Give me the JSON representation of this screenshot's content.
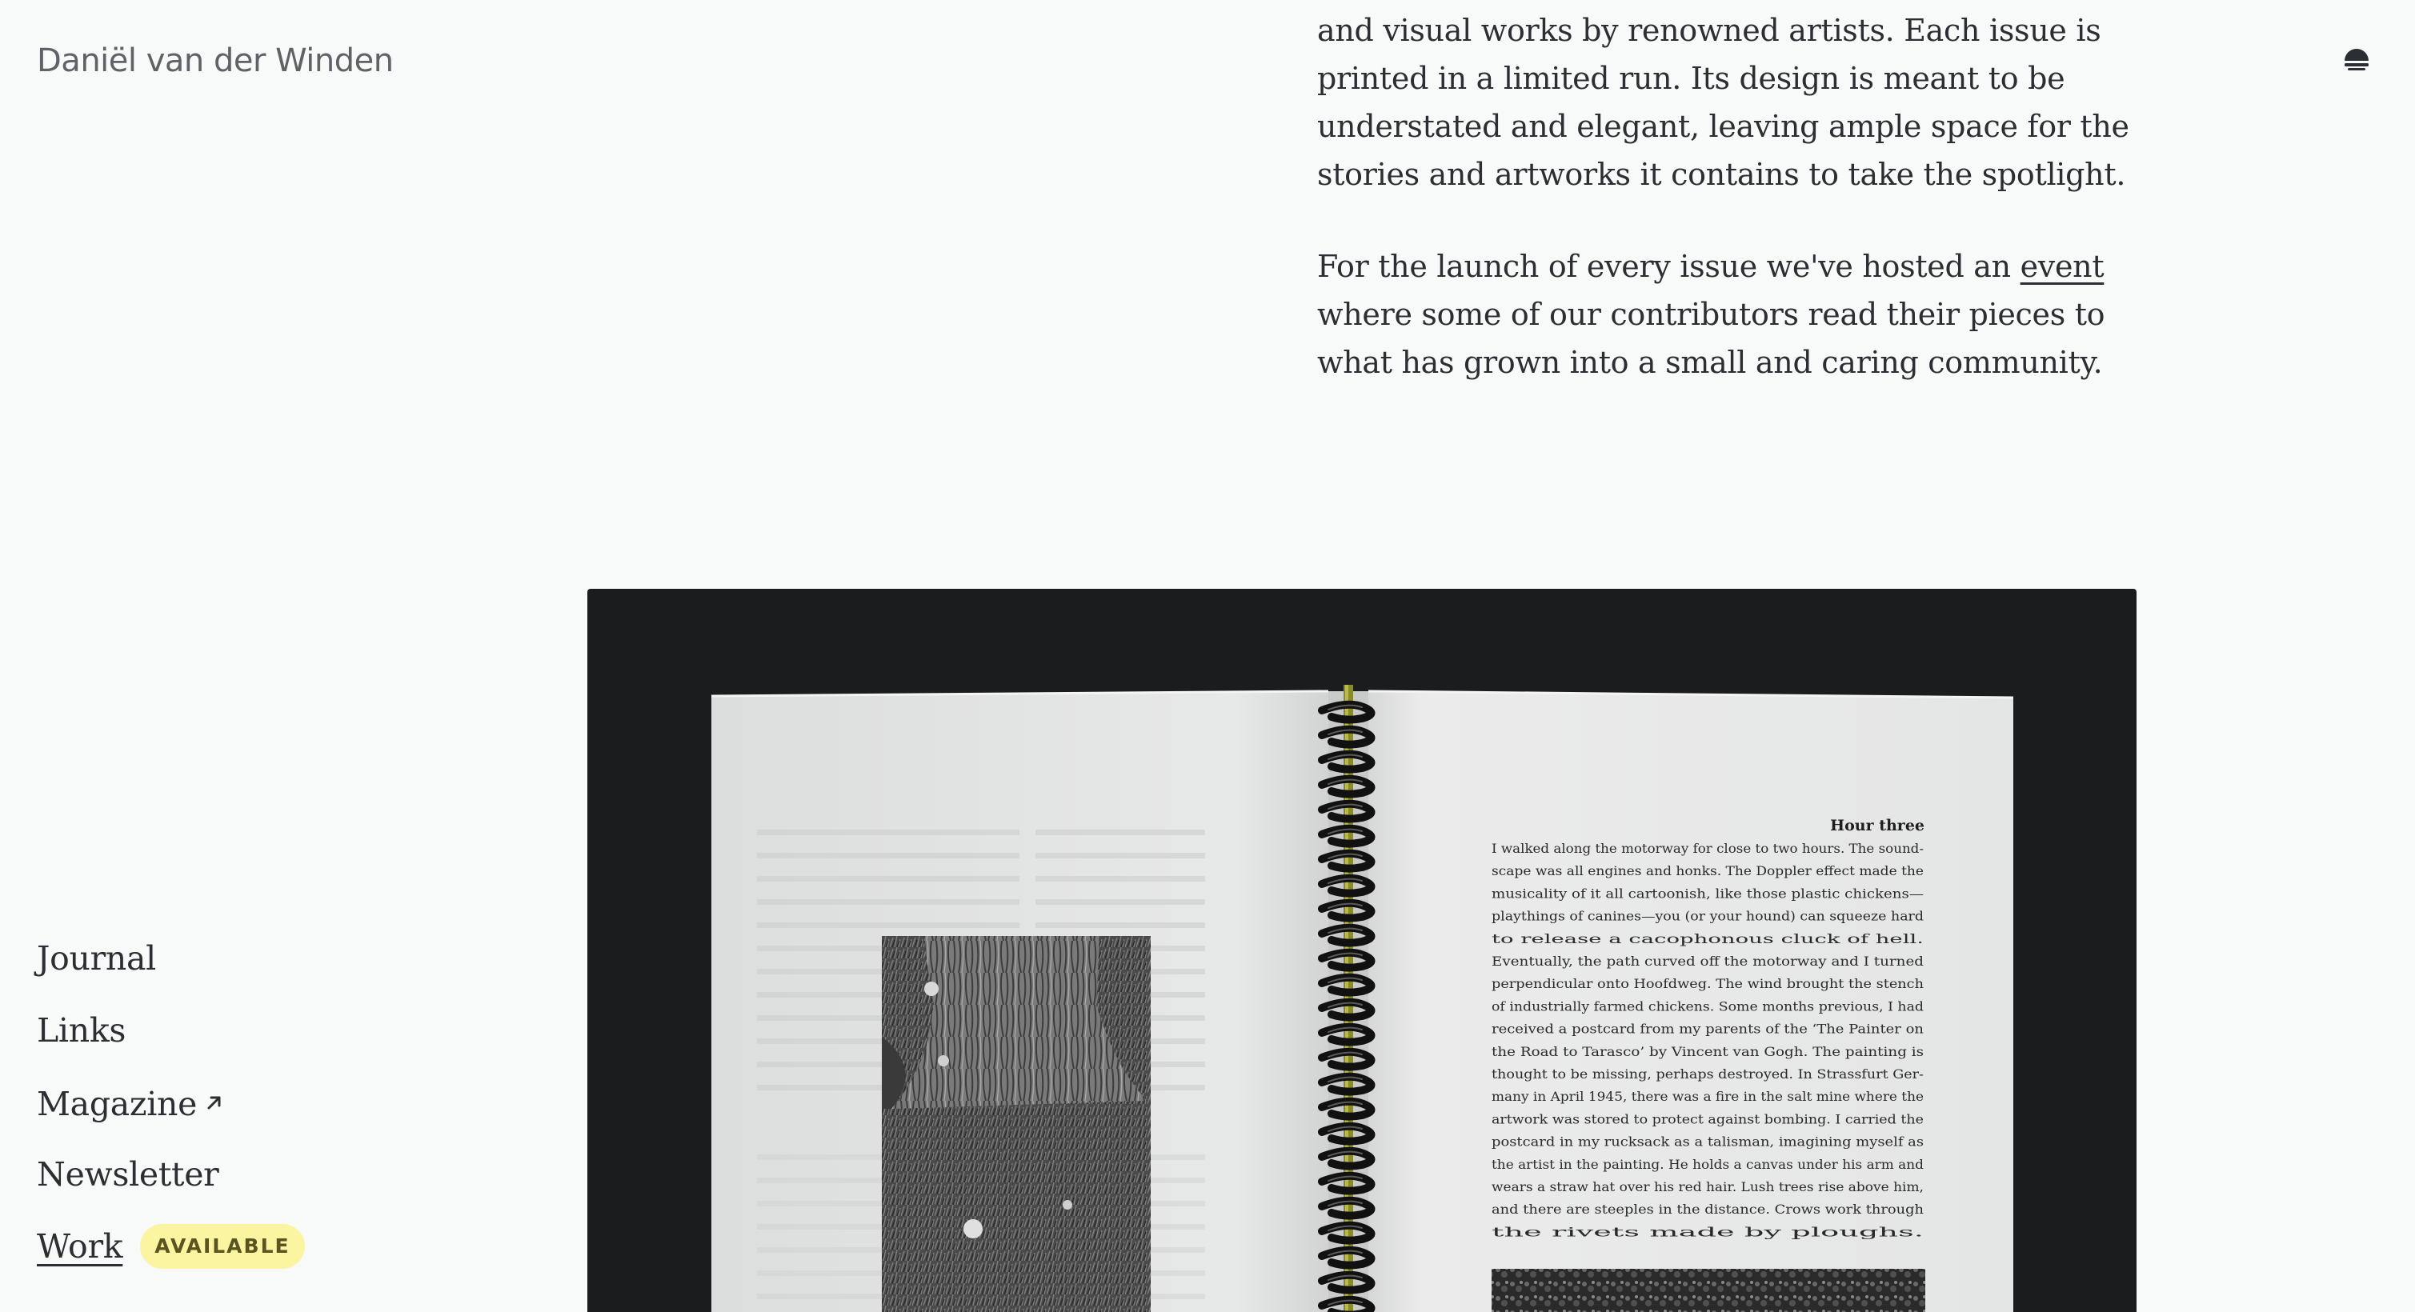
{
  "site": {
    "title": "Daniël van der Winden"
  },
  "header": {
    "theme_toggle_icon": "half-moon-icon"
  },
  "article": {
    "paragraph_1": "and visual works by renowned artists. Each issue is printed in a limited run. Its design is meant to be understated and elegant, leaving ample space for the stories and artworks it contains to take the spotlight.",
    "paragraph_2_before": "For the launch of every issue we've hosted an ",
    "paragraph_2_link": "event",
    "paragraph_2_after": " where some of our contributors read their pieces to what has grown into a small and caring community."
  },
  "photo": {
    "page_heading": "Hour three",
    "page_lines": [
      "I walked along the motorway for close to two hours. The sound-",
      "scape was all engines and honks. The Doppler effect made the",
      "musicality of it all cartoonish, like those plastic chickens—",
      "playthings of canines—you (or your hound) can squeeze hard",
      "to release a cacophonous cluck of hell.",
      "     Eventually, the path curved off the motorway and I turned",
      "perpendicular onto Hoofdweg. The wind brought the stench",
      "of industrially farmed chickens. Some months previous, I had",
      "received a postcard from my parents of the ‘The Painter on",
      "the Road to Tarasco’ by Vincent van Gogh. The painting is",
      "thought to be missing, perhaps destroyed. In Strassfurt Ger-",
      "many in April 1945, there was a fire in the salt mine where the",
      "artwork was stored to protect against bombing. I carried the",
      "postcard in my rucksack as a talisman, imagining myself as",
      "the artist in the painting. He holds a canvas under his arm and",
      "wears a straw hat over his red hair. Lush trees rise above him,",
      "and there are steeples in the distance. Crows work through",
      "the rivets made by ploughs."
    ]
  },
  "nav": {
    "journal": "Journal",
    "links": "Links",
    "magazine": "Magazine",
    "magazine_icon": "arrow-up-right-icon",
    "newsletter": "Newsletter",
    "work": "Work",
    "work_badge": "AVAILABLE"
  },
  "colors": {
    "background": "#f8f9f9",
    "text": "#2b2f33",
    "badge_bg": "#fbf4a0",
    "photo_bg": "#1b1c1e"
  }
}
